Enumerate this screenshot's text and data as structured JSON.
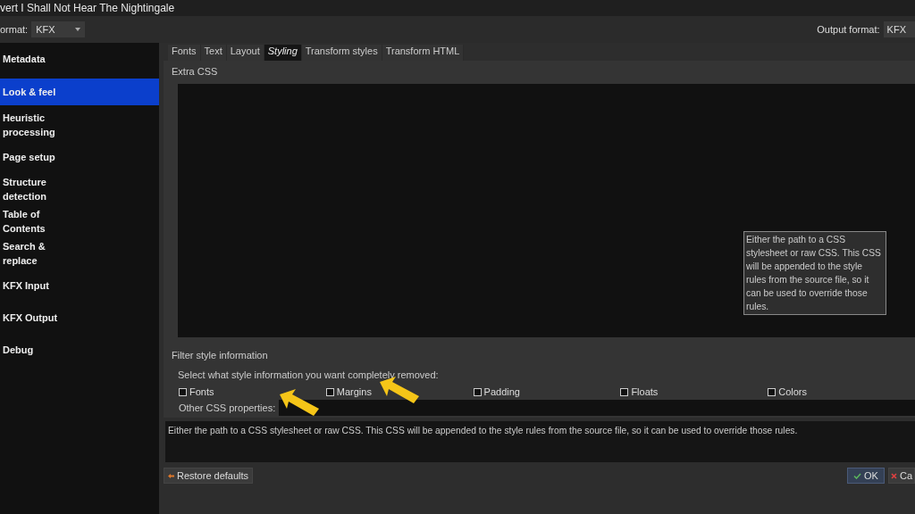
{
  "window": {
    "title": "vert I Shall Not Hear The Nightingale"
  },
  "input_format": {
    "label": "ormat:",
    "value": "KFX"
  },
  "output_format": {
    "label": "Output format:",
    "value": "KFX"
  },
  "sidebar": {
    "items": [
      {
        "label": "Metadata",
        "selected": false
      },
      {
        "label": "Look & feel",
        "selected": true
      },
      {
        "label": "Heuristic processing",
        "selected": false
      },
      {
        "label": "Page setup",
        "selected": false
      },
      {
        "label": "Structure detection",
        "selected": false
      },
      {
        "label": "Table of Contents",
        "selected": false
      },
      {
        "label": "Search & replace",
        "selected": false
      },
      {
        "label": "KFX Input",
        "selected": false
      },
      {
        "label": "KFX Output",
        "selected": false
      },
      {
        "label": "Debug",
        "selected": false
      }
    ]
  },
  "tabs": [
    {
      "label": "Fonts",
      "selected": false
    },
    {
      "label": "Text",
      "selected": false
    },
    {
      "label": "Layout",
      "selected": false
    },
    {
      "label": "Styling",
      "selected": true
    },
    {
      "label": "Transform styles",
      "selected": false
    },
    {
      "label": "Transform HTML",
      "selected": false
    }
  ],
  "extra_css": {
    "label": "Extra CSS",
    "tooltip": "Either the path to a CSS stylesheet or raw CSS. This CSS will be appended to the style rules from the source file, so it can be used to override those rules."
  },
  "filter": {
    "title": "Filter style information",
    "prompt": "Select what style information you want completely removed:",
    "options": [
      {
        "label": "Fonts",
        "checked": false
      },
      {
        "label": "Margins",
        "checked": false
      },
      {
        "label": "Padding",
        "checked": false
      },
      {
        "label": "Floats",
        "checked": false
      },
      {
        "label": "Colors",
        "checked": false
      }
    ],
    "other_label": "Other CSS properties:"
  },
  "help_text": "Either the path to a CSS stylesheet or raw CSS. This CSS will be appended to the style rules from the source file, so it can be used to override those rules.",
  "buttons": {
    "restore": "Restore defaults",
    "ok": "OK",
    "cancel": "Ca"
  }
}
